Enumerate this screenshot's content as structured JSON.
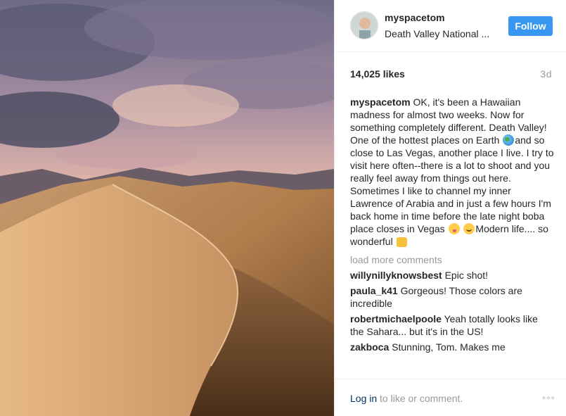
{
  "post": {
    "username": "myspacetom",
    "location": "Death Valley National ...",
    "follow_label": "Follow",
    "likes": "14,025 likes",
    "time_ago": "3d",
    "caption": {
      "username": "myspacetom",
      "part1": "OK, it's been a Hawaiian madness for almost two weeks. Now for something completely different. Death Valley! One of the hottest places on Earth ",
      "emoji1": "globe-emoji",
      "part2": "and so close to Las Vegas, another place I live. I try to visit here often--there is a lot to shoot and you really feel away from things out here. Sometimes I like to channel my inner Lawrence of Arabia and in just a few hours I'm back home in time before the late night boba place closes in Vegas ",
      "emoji2": "yum-emoji",
      "emoji3": "smile-emoji",
      "part3": "Modern life.... so wonderful ",
      "emoji4": "thumbs-up-emoji"
    },
    "load_more_label": "load more comments",
    "comments": [
      {
        "username": "willynillyknowsbest",
        "text": "Epic shot!"
      },
      {
        "username": "paula_k41",
        "text": "Gorgeous! Those colors are incredible"
      },
      {
        "username": "robertmichaelpoole",
        "text": "Yeah totally looks like the Sahara... but it's in the US!"
      },
      {
        "username": "zakboca",
        "text": "Stunning, Tom. Makes me"
      }
    ],
    "login_link": "Log in",
    "login_suffix": " to like or comment.",
    "more_icon": "ellipsis-icon"
  },
  "colors": {
    "accent": "#3897f0",
    "link": "#003569",
    "muted": "#999999"
  }
}
